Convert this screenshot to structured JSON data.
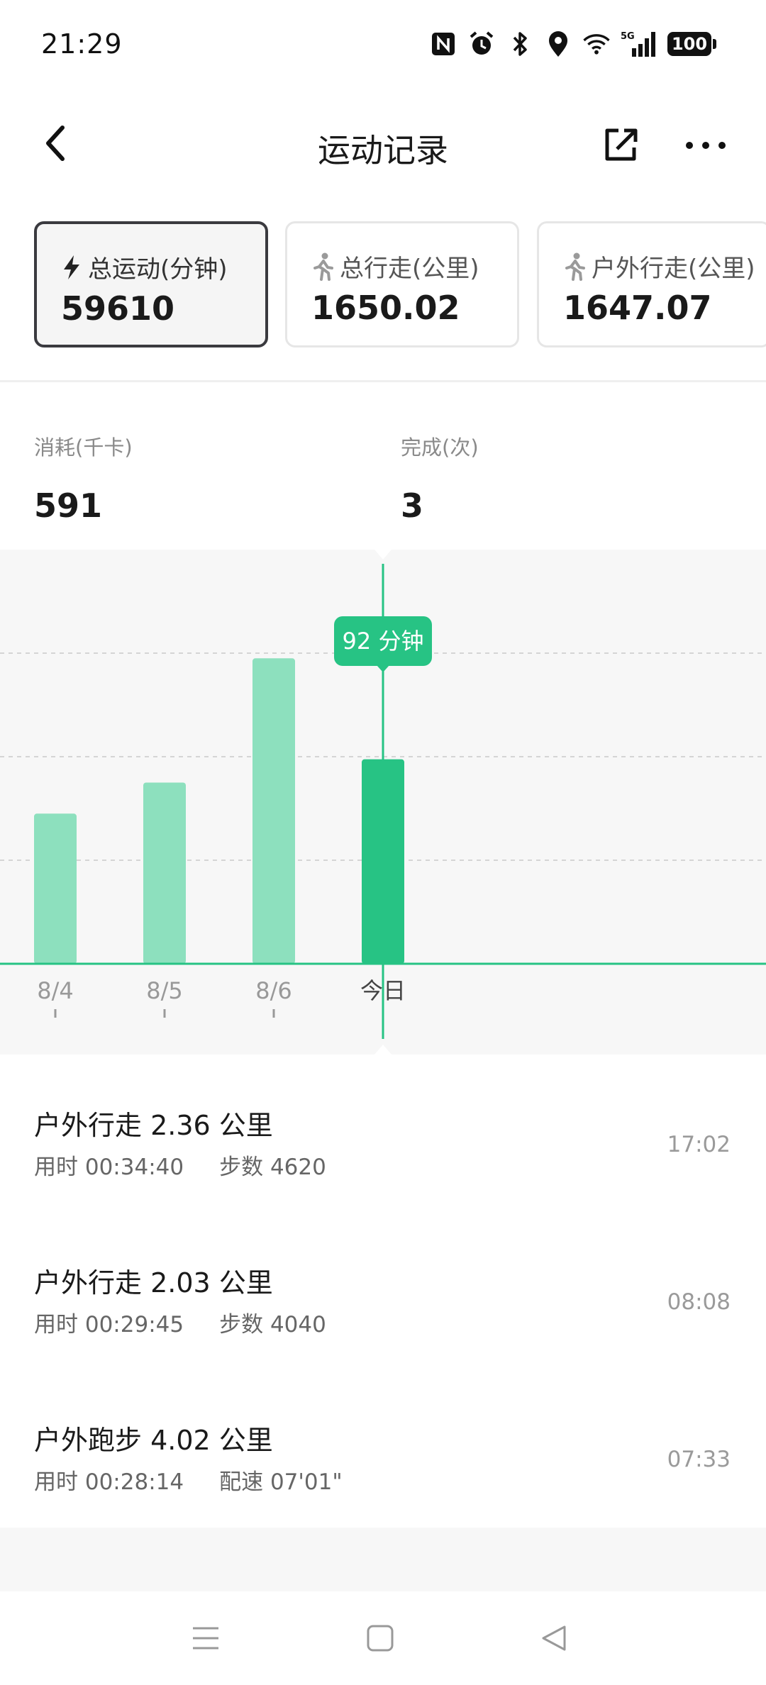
{
  "status_bar": {
    "time": "21:29",
    "icons": [
      "nfc-icon",
      "alarm-icon",
      "bluetooth-icon",
      "location-icon",
      "wifi-icon",
      "signal-5g-icon"
    ],
    "signal_label": "5G",
    "battery": "100"
  },
  "header": {
    "title": "运动记录",
    "back_icon": "chevron-left-icon",
    "share_icon": "share-icon",
    "more_icon": "more-icon"
  },
  "tabs": [
    {
      "icon": "lightning-icon",
      "label": "总运动(分钟)",
      "value": "59610",
      "active": true
    },
    {
      "icon": "walk-icon",
      "label": "总行走(公里)",
      "value": "1650.02",
      "active": false
    },
    {
      "icon": "walk-icon",
      "label": "户外行走(公里)",
      "value": "1647.07",
      "active": false
    }
  ],
  "stats": [
    {
      "label": "消耗(千卡)",
      "value": "591"
    },
    {
      "label": "完成(次)",
      "value": "3"
    }
  ],
  "chart_data": {
    "type": "bar",
    "categories": [
      "8/4",
      "8/5",
      "8/6",
      "今日"
    ],
    "values": [
      58,
      70,
      118,
      79
    ],
    "unit": "分钟",
    "highlight_index": 3,
    "tooltip": "92 分钟",
    "ylim": [
      0,
      160
    ],
    "gridlines": [
      40,
      80,
      120
    ],
    "grid": true,
    "colors": {
      "bar": "#8de0be",
      "highlight": "#27c384",
      "line": "#27c384"
    }
  },
  "records": [
    {
      "title": "户外行走 2.36 公里",
      "duration": "用时 00:34:40",
      "extra": "步数 4620",
      "time": "17:02"
    },
    {
      "title": "户外行走 2.03 公里",
      "duration": "用时 00:29:45",
      "extra": "步数 4040",
      "time": "08:08"
    },
    {
      "title": "户外跑步 4.02 公里",
      "duration": "用时 00:28:14",
      "extra": "配速 07'01\"",
      "time": "07:33"
    }
  ],
  "nav": {
    "menu_icon": "menu-icon",
    "home_icon": "home-icon",
    "back_icon": "back-triangle-icon"
  }
}
